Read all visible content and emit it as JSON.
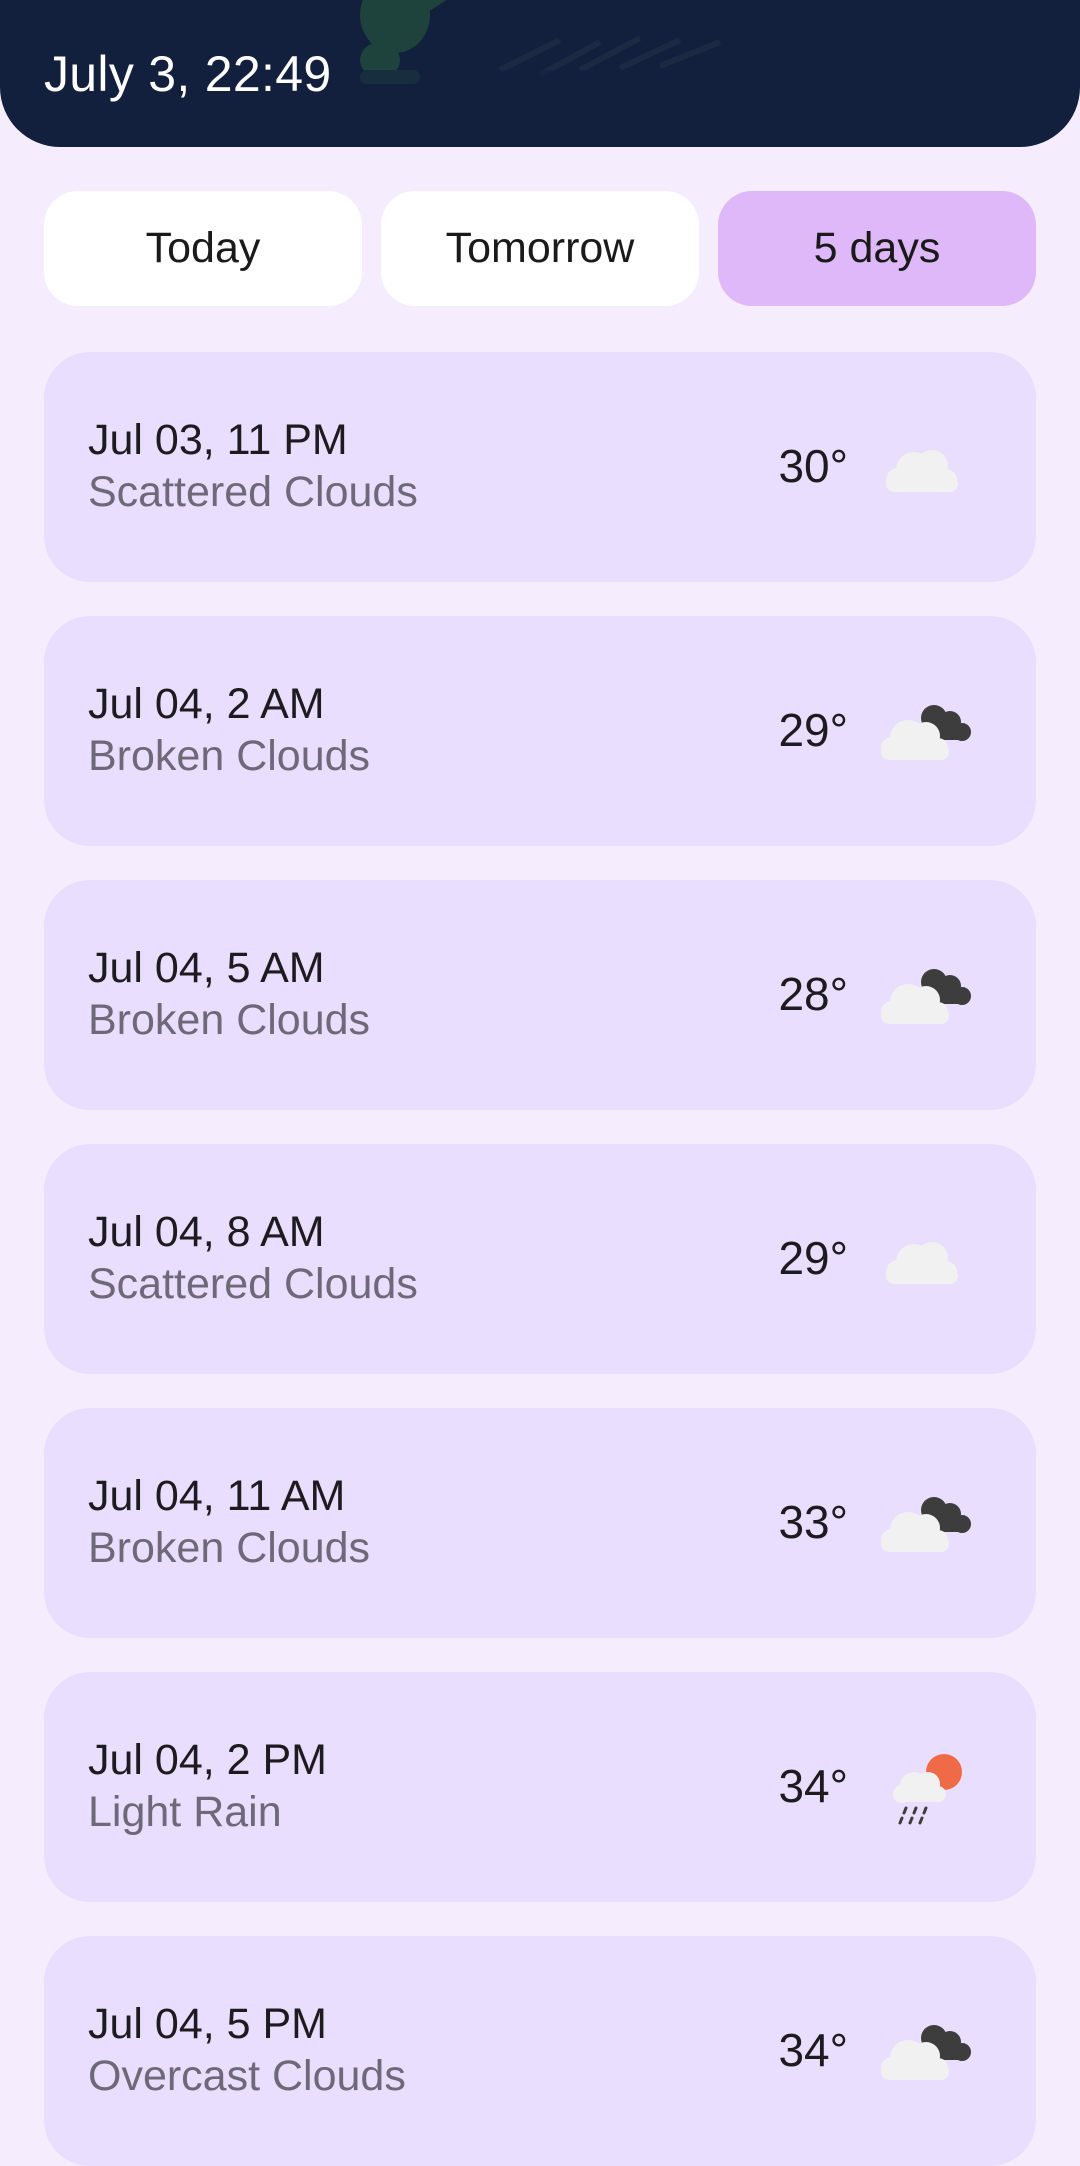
{
  "header": {
    "title": "July 3, 22:49"
  },
  "tabs": [
    {
      "label": "Today",
      "selected": false
    },
    {
      "label": "Tomorrow",
      "selected": false
    },
    {
      "label": "5 days",
      "selected": true
    }
  ],
  "colors": {
    "header_bg": "#121f3d",
    "page_bg": "#f5edfd",
    "card_bg": "#e9defd",
    "tab_selected": "#dfb8f9",
    "sun": "#ef6b47"
  },
  "forecast": [
    {
      "time": "Jul 03, 11 PM",
      "description": "Scattered Clouds",
      "temp": "30°",
      "icon": "scattered-clouds-icon"
    },
    {
      "time": "Jul 04, 2 AM",
      "description": "Broken Clouds",
      "temp": "29°",
      "icon": "broken-clouds-icon"
    },
    {
      "time": "Jul 04, 5 AM",
      "description": "Broken Clouds",
      "temp": "28°",
      "icon": "broken-clouds-icon"
    },
    {
      "time": "Jul 04, 8 AM",
      "description": "Scattered Clouds",
      "temp": "29°",
      "icon": "scattered-clouds-icon"
    },
    {
      "time": "Jul 04, 11 AM",
      "description": "Broken Clouds",
      "temp": "33°",
      "icon": "broken-clouds-icon"
    },
    {
      "time": "Jul 04, 2 PM",
      "description": "Light Rain",
      "temp": "34°",
      "icon": "light-rain-icon"
    },
    {
      "time": "Jul 04, 5 PM",
      "description": "Overcast Clouds",
      "temp": "34°",
      "icon": "overcast-clouds-icon"
    }
  ]
}
